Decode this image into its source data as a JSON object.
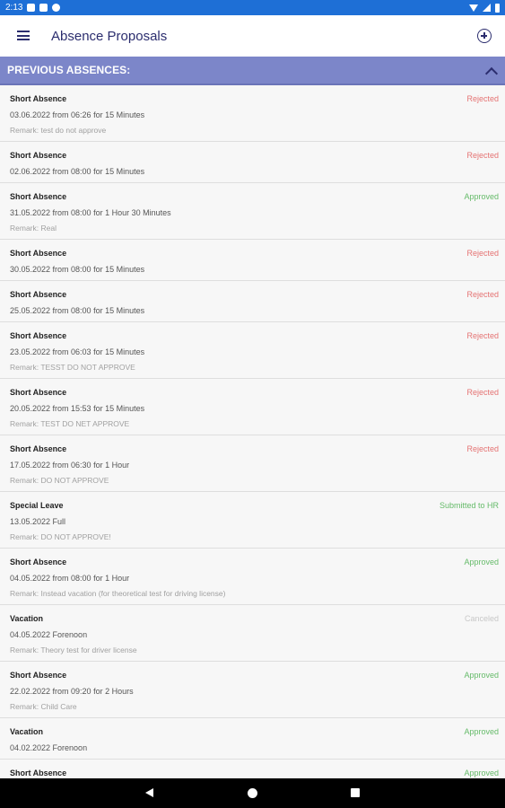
{
  "status_bar": {
    "time": "2:13",
    "left_icons": [
      "notification-icon",
      "sim-card-icon",
      "vpn-icon"
    ],
    "right_icons": [
      "wifi-icon",
      "signal-icon",
      "battery-icon"
    ]
  },
  "app_bar": {
    "title": "Absence Proposals",
    "menu_icon": "menu-icon",
    "add_icon": "add-circle-icon"
  },
  "section": {
    "title": "PREVIOUS ABSENCES:",
    "toggle_icon": "chevron-up-icon"
  },
  "status_colors": {
    "Rejected": "#e57373",
    "Approved": "#66bb6a",
    "Submitted to HR": "#66bb6a",
    "Canceled": "#c8c8c8"
  },
  "absences": [
    {
      "type": "Short Absence",
      "date": "03.06.2022 from 06:26 for 15 Minutes",
      "remark": "Remark: test do not approve",
      "status": "Rejected"
    },
    {
      "type": "Short Absence",
      "date": "02.06.2022 from 08:00 for 15 Minutes",
      "remark": "",
      "status": "Rejected"
    },
    {
      "type": "Short Absence",
      "date": "31.05.2022 from 08:00 for 1 Hour 30 Minutes",
      "remark": "Remark: Real",
      "status": "Approved"
    },
    {
      "type": "Short Absence",
      "date": "30.05.2022 from 08:00 for 15 Minutes",
      "remark": "",
      "status": "Rejected"
    },
    {
      "type": "Short Absence",
      "date": "25.05.2022 from 08:00 for 15 Minutes",
      "remark": "",
      "status": "Rejected"
    },
    {
      "type": "Short Absence",
      "date": "23.05.2022 from 06:03 for 15 Minutes",
      "remark": "Remark: TESST DO NOT APPROVE",
      "status": "Rejected"
    },
    {
      "type": "Short Absence",
      "date": "20.05.2022 from 15:53 for 15 Minutes",
      "remark": "Remark: TEST DO NET APPROVE",
      "status": "Rejected"
    },
    {
      "type": "Short Absence",
      "date": "17.05.2022 from 06:30 for 1 Hour",
      "remark": "Remark: DO NOT APPROVE",
      "status": "Rejected"
    },
    {
      "type": "Special Leave",
      "date": "13.05.2022 Full",
      "remark": "Remark: DO NOT APPROVE!",
      "status": "Submitted to HR"
    },
    {
      "type": "Short Absence",
      "date": "04.05.2022 from 08:00 for 1 Hour",
      "remark": "Remark: Instead vacation (for theoretical test for driving license)",
      "status": "Approved"
    },
    {
      "type": "Vacation",
      "date": "04.05.2022 Forenoon",
      "remark": "Remark: Theory test for driver license",
      "status": "Canceled"
    },
    {
      "type": "Short Absence",
      "date": "22.02.2022 from 09:20 for 2 Hours",
      "remark": "Remark: Child Care",
      "status": "Approved"
    },
    {
      "type": "Vacation",
      "date": "04.02.2022 Forenoon",
      "remark": "",
      "status": "Approved"
    },
    {
      "type": "Short Absence",
      "date": "",
      "remark": "",
      "status": "Approved"
    }
  ],
  "nav_bar": {
    "icons": [
      "back-icon",
      "home-icon",
      "recents-icon"
    ]
  }
}
